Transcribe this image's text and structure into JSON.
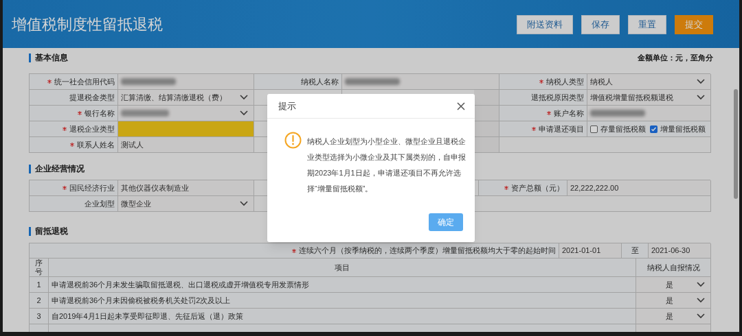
{
  "header": {
    "title": "增值税制度性留抵退税",
    "buttons": [
      {
        "label": "附送资料",
        "kind": "default"
      },
      {
        "label": "保存",
        "kind": "default"
      },
      {
        "label": "重置",
        "kind": "default"
      },
      {
        "label": "提交",
        "kind": "primary"
      }
    ]
  },
  "basic_info": {
    "title": "基本信息",
    "unit_note": "金额单位：元，至角分",
    "rows": [
      [
        {
          "kind": "label",
          "text": "统一社会信用代码",
          "required": true
        },
        {
          "kind": "redacted"
        },
        {
          "kind": "label",
          "text": "纳税人名称",
          "required": false
        },
        {
          "kind": "redacted"
        },
        {
          "kind": "label",
          "text": "纳税人类型",
          "required": true
        },
        {
          "kind": "select",
          "text": "纳税人"
        }
      ],
      [
        {
          "kind": "label",
          "text": "提退税金类型",
          "required": false
        },
        {
          "kind": "select",
          "text": "汇算清缴、结算清缴退税（费）"
        },
        {
          "kind": "empty"
        },
        {
          "kind": "empty"
        },
        {
          "kind": "label",
          "text": "退抵税原因类型",
          "required": false
        },
        {
          "kind": "select",
          "text": "增值税增量留抵税额退税"
        }
      ],
      [
        {
          "kind": "label",
          "text": "银行名称",
          "required": true
        },
        {
          "kind": "redacted_select"
        },
        {
          "kind": "empty"
        },
        {
          "kind": "empty"
        },
        {
          "kind": "label",
          "text": "账户名称",
          "required": true
        },
        {
          "kind": "redacted"
        }
      ],
      [
        {
          "kind": "label",
          "text": "退税企业类型",
          "required": true
        },
        {
          "kind": "highlight"
        },
        {
          "kind": "empty"
        },
        {
          "kind": "empty"
        },
        {
          "kind": "label",
          "text": "申请退还项目",
          "required": true
        },
        {
          "kind": "checks",
          "options": [
            {
              "label": "存量留抵税额",
              "checked": false
            },
            {
              "label": "增量留抵税额",
              "checked": true
            }
          ]
        }
      ],
      [
        {
          "kind": "label",
          "text": "联系人姓名",
          "required": true
        },
        {
          "kind": "value",
          "text": "测试人"
        },
        {
          "kind": "empty"
        },
        {
          "kind": "empty"
        },
        {
          "kind": "blank"
        }
      ]
    ]
  },
  "operations": {
    "title": "企业经营情况",
    "rows": [
      [
        {
          "kind": "label",
          "text": "国民经济行业",
          "required": true
        },
        {
          "kind": "value",
          "text": "其他仪器仪表制造业"
        },
        {
          "kind": "empty"
        },
        {
          "kind": "empty"
        },
        {
          "kind": "label",
          "text": "资产总额（元）",
          "required": true
        },
        {
          "kind": "value",
          "text": "22,222,222.00"
        }
      ],
      [
        {
          "kind": "label",
          "text": "企业划型",
          "required": false
        },
        {
          "kind": "select",
          "text": "微型企业"
        },
        {
          "kind": "blank"
        }
      ]
    ]
  },
  "refund": {
    "title": "留抵退税",
    "period_label": "连续六个月（按季纳税的，连续两个季度）增量留抵税额均大于零的起始时间",
    "period_required": true,
    "period_start": "2021-01-01",
    "period_to": "至",
    "period_end": "2021-06-30",
    "columns": [
      "序号",
      "项目",
      "纳税人自报情况"
    ],
    "rows": [
      {
        "no": "1",
        "item": "申请退税前36个月未发生骗取留抵退税、出口退税或虚开增值税专用发票情形",
        "answer": "是"
      },
      {
        "no": "2",
        "item": "申请退税前36个月未因偷税被税务机关处罚2次及以上",
        "answer": "是"
      },
      {
        "no": "3",
        "item": "自2019年4月1日起未享受即征即退、先征后返（退）政策",
        "answer": "是"
      }
    ]
  },
  "dialog": {
    "title": "提示",
    "message": "纳税人企业划型为小型企业、微型企业且退税企业类型选择为小微企业及其下属类别的，自申报期2023年1月1日起，申请退还项目不再允许选择“增量留抵税额”。",
    "button": "确定"
  }
}
